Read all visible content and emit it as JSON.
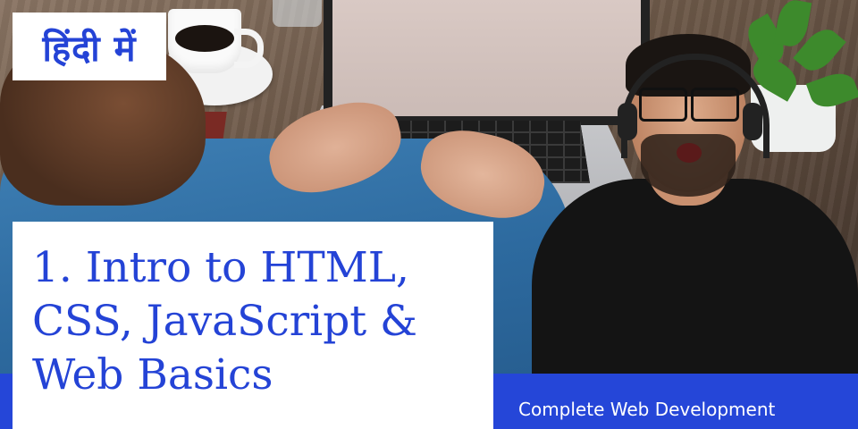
{
  "badge": {
    "hindi_label": "हिंदी में"
  },
  "title": {
    "lines": [
      "1. Intro to HTML,",
      "CSS, JavaScript &",
      "Web Basics"
    ]
  },
  "footer": {
    "series_label": "Complete Web Development"
  },
  "colors": {
    "accent_blue": "#2546d8",
    "text_blue": "#2443d6",
    "box_white": "#ffffff"
  }
}
